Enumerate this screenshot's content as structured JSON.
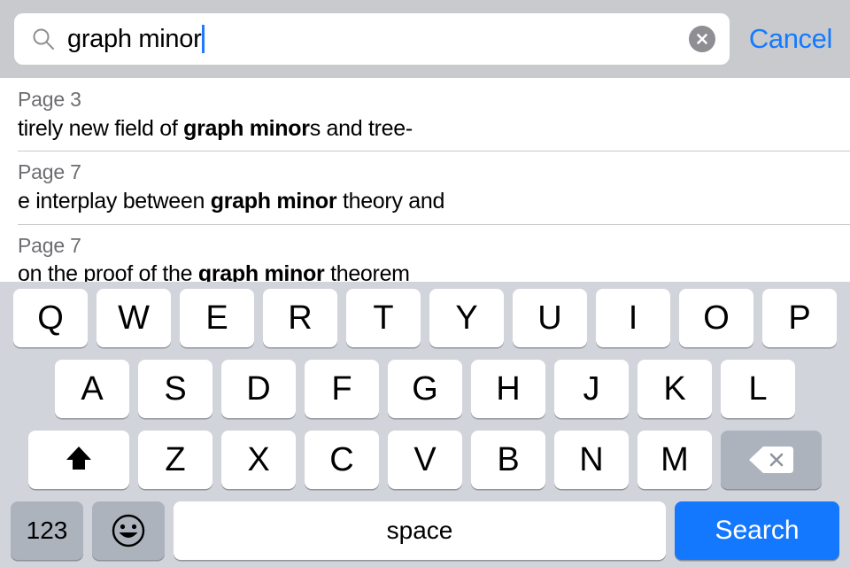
{
  "search": {
    "query": "graph minor",
    "placeholder": "Search",
    "search_icon": "magnifier-icon",
    "clear_icon": "clear-circle-icon",
    "cancel_label": "Cancel",
    "accent_color": "#137bff",
    "caret_color": "#1f7afc",
    "bar_background": "#c9cace"
  },
  "results": [
    {
      "page_label": "Page 3",
      "snippet_before": "tirely new field of ",
      "snippet_match": "graph minor",
      "snippet_after": "s and tree-"
    },
    {
      "page_label": "Page 7",
      "snippet_before": "e interplay between ",
      "snippet_match": "graph minor",
      "snippet_after": " theory and"
    },
    {
      "page_label": "Page 7",
      "snippet_before": "on the proof of the ",
      "snippet_match": "graph minor",
      "snippet_after": " theorem"
    }
  ],
  "keyboard": {
    "row1": [
      "Q",
      "W",
      "E",
      "R",
      "T",
      "Y",
      "U",
      "I",
      "O",
      "P"
    ],
    "row2": [
      "A",
      "S",
      "D",
      "F",
      "G",
      "H",
      "J",
      "K",
      "L"
    ],
    "row3": [
      "Z",
      "X",
      "C",
      "V",
      "B",
      "N",
      "M"
    ],
    "shift_icon": "shift-arrow-icon",
    "backspace_icon": "backspace-delete-icon",
    "numbers_label": "123",
    "emoji_icon": "smiley-face-icon",
    "space_label": "space",
    "search_label": "Search",
    "search_key_color": "#1478ff",
    "background": "#d1d4da",
    "key_color": "#ffffff",
    "modifier_key_color": "#adb3bd"
  }
}
